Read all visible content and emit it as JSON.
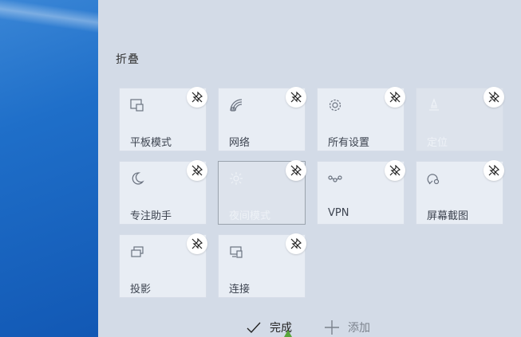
{
  "section_title": "折叠",
  "tiles": [
    {
      "label": "平板模式",
      "icon": "tablet-mode-icon",
      "state": "normal"
    },
    {
      "label": "网络",
      "icon": "network-icon",
      "state": "normal"
    },
    {
      "label": "所有设置",
      "icon": "settings-gear-icon",
      "state": "normal"
    },
    {
      "label": "定位",
      "icon": "location-icon",
      "state": "disabled"
    },
    {
      "label": "专注助手",
      "icon": "focus-assist-moon-icon",
      "state": "normal"
    },
    {
      "label": "夜间模式",
      "icon": "night-light-icon",
      "state": "disabled"
    },
    {
      "label": "VPN",
      "icon": "vpn-icon",
      "state": "normal"
    },
    {
      "label": "屏幕截图",
      "icon": "screen-snip-icon",
      "state": "normal"
    },
    {
      "label": "投影",
      "icon": "project-icon",
      "state": "normal"
    },
    {
      "label": "连接",
      "icon": "connect-icon",
      "state": "normal"
    }
  ],
  "actions": {
    "done_label": "完成",
    "add_label": "添加"
  },
  "colors": {
    "panel_bg": "#d3dbe7",
    "tile_bg": "#e8edf4",
    "desktop_blue": "#1f6fc9"
  }
}
